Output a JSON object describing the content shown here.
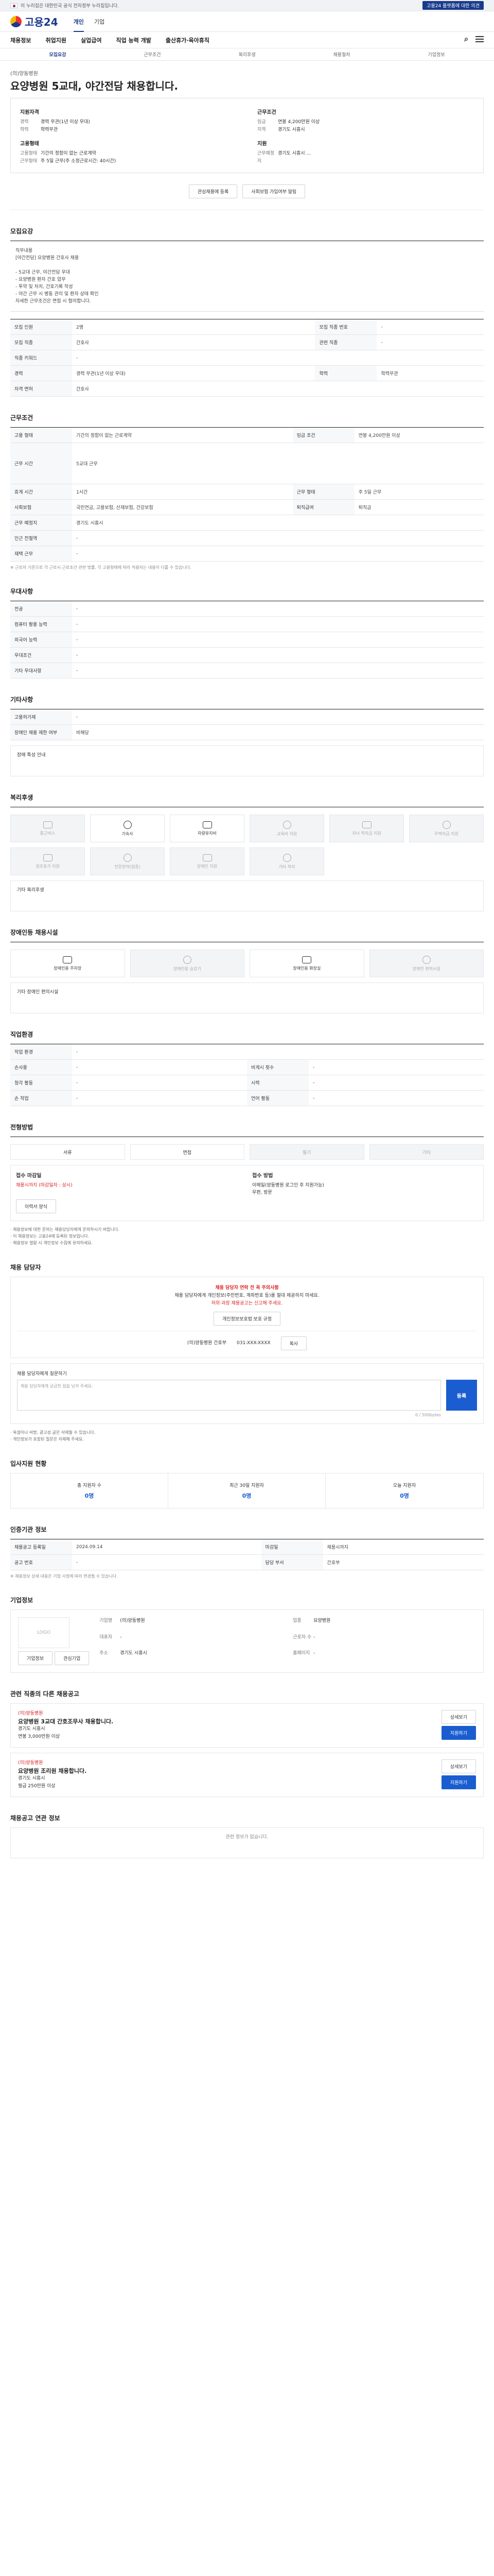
{
  "util": {
    "left_text": "이 누리집은 대한민국 공식 전자정부 누리집입니다.",
    "right_pill": "고용24 플랫폼에 대한 의견"
  },
  "header": {
    "logo": "고용24",
    "tabs": [
      "개인",
      "기업"
    ]
  },
  "gnb": [
    "채용정보",
    "취업지원",
    "실업급여",
    "직업 능력 개발",
    "출산휴가·육아휴직"
  ],
  "subtabs": [
    "모집요강",
    "근무조건",
    "복리후생",
    "채용절차",
    "기업정보"
  ],
  "title": {
    "company": "(의)양동병원",
    "heading": "요양병원 5교대, 야간전담 채용합니다."
  },
  "summary": {
    "left_head1": "지원자격",
    "left_rows1": [
      [
        "경력",
        "경력 무관(1년 이상 우대)"
      ],
      [
        "학력",
        "학력무관"
      ]
    ],
    "left_head2": "고용형태",
    "left_rows2": [
      [
        "고용형태",
        "기간의 정함이 없는 근로계약"
      ],
      [
        "근무형태",
        "주 5일 근무(주 소정근로시간: 40시간)"
      ]
    ],
    "right_head1": "근무조건",
    "right_rows1": [
      [
        "임금",
        "연봉 4,200만원 이상"
      ],
      [
        "지역",
        "경기도 시흥시"
      ]
    ],
    "right_head2": "지원",
    "right_rows2": [
      [
        "근무예정지",
        "경기도 시흥시 ..."
      ]
    ]
  },
  "summary_btns": {
    "b1": "관심채용에 등록",
    "b2": "사회보험 가입여부 알림"
  },
  "sections": {
    "recruit": "모집요강",
    "work": "근무조건",
    "pref": "우대사항",
    "etc": "기타사항",
    "welfare": "복리후생",
    "disabled": "장애인등 채용시설",
    "job": "직업환경",
    "process": "전형방법",
    "apply": "채용 담당자",
    "stats": "입사지원 현황",
    "info": "인증기관 정보",
    "company": "기업정보",
    "related": "관련 직종의 다른 채용공고",
    "similar": "채용공고 연관 정보"
  },
  "recruit_text": "직무내용\n[야간전담] 요양병원 간호사 채용\n\n- 5교대 근무, 야간전담 우대\n- 요양병원 환자 간호 업무\n- 투약 및 처치, 간호기록 작성\n- 야간 근무 시 병동 관리 및 환자 상태 확인\n자세한 근무조건은 면접 시 협의합니다.",
  "recruit_rows": [
    [
      "모집 인원",
      "2명",
      "모집 직종 번호",
      "-"
    ],
    [
      "모집 직종",
      "간호사",
      "관련 직종",
      "-"
    ],
    [
      "직종 키워드",
      "-",
      "",
      ""
    ],
    [
      "경력",
      "경력 무관(1년 이상 우대)",
      "학력",
      "학력무관"
    ],
    [
      "자격 면허",
      "간호사",
      "",
      ""
    ]
  ],
  "work_rows": [
    [
      "고용 형태",
      "기간의 정함이 없는 근로계약",
      "임금 조건",
      "연봉 4,200만원 이상"
    ],
    [
      "근무 시간",
      "5교대 근무",
      "",
      ""
    ],
    [
      "휴게 시간",
      "1시간",
      "근무 형태",
      "주 5일 근무"
    ],
    [
      "사회보험",
      "국민연금, 고용보험, 산재보험, 건강보험",
      "퇴직급여",
      "퇴직금"
    ],
    [
      "근무 예정지",
      "경기도 시흥시",
      "",
      ""
    ],
    [
      "인근 전철역",
      "-",
      "",
      ""
    ],
    [
      "재택 근무",
      "-",
      "",
      ""
    ]
  ],
  "work_note": "※ 근로자 기준으로 각 근로시 근로조건 관련 법률, 각 고용형태에 따라 적용되는 내용이 다를 수 있습니다.",
  "pref_rows": [
    [
      "전공",
      "-"
    ],
    [
      "컴퓨터 활용 능력",
      "-"
    ],
    [
      "외국어 능력",
      "-"
    ],
    [
      "우대조건",
      "-"
    ],
    [
      "기타 우대사항",
      "-"
    ]
  ],
  "etc_rows": [
    [
      "고용허가제",
      "-"
    ],
    [
      "장애인 채용 제한 여부",
      "비해당"
    ]
  ],
  "etc_note": "장애 특성 안내",
  "welfare_cards": [
    {
      "label": "통근버스",
      "on": false
    },
    {
      "label": "기숙사",
      "on": true
    },
    {
      "label": "차량유지비",
      "on": true
    },
    {
      "label": "교육비 지원",
      "on": false
    },
    {
      "label": "자녀 학자금 지원",
      "on": false
    },
    {
      "label": "주택자금 지원",
      "on": false
    },
    {
      "label": "경조휴가 지원",
      "on": false
    },
    {
      "label": "전문분야(업종)",
      "on": false
    },
    {
      "label": "장애인 지원",
      "on": false
    },
    {
      "label": "기타 복리",
      "on": false
    }
  ],
  "welfare_etc": "기타 복리후생",
  "disabled_cards": [
    {
      "label": "장애인용 주차장",
      "on": true
    },
    {
      "label": "장애인용 승강기",
      "on": false
    },
    {
      "label": "장애인용 화장실",
      "on": true
    },
    {
      "label": "장애인 편의시설",
      "on": false
    }
  ],
  "disabled_etc": "기타 장애인 편의시설",
  "job_rows": [
    [
      "작업 환경",
      "-",
      "",
      ""
    ],
    [
      "손사용",
      "-",
      "비게시 횟수",
      "-"
    ],
    [
      "청각 활동",
      "-",
      "시력",
      "-"
    ],
    [
      "손 작업",
      "-",
      "언어 활동",
      "-"
    ]
  ],
  "process_steps": [
    {
      "label": "서류",
      "on": true
    },
    {
      "label": "면접",
      "on": true
    },
    {
      "label": "필기",
      "on": false
    },
    {
      "label": "기타",
      "on": false
    }
  ],
  "apply_info": {
    "h1": "접수 마감일",
    "d1": "채용시까지 (마감일자 : 상시)",
    "h2": "접수 방법",
    "d2": "이메일(양동병원 로그인 후 지원가능)",
    "d3": "우편, 방문",
    "btn": "이력서 양식"
  },
  "apply_bullets": [
    "· 채용정보에 대한 문의는 채용담당자에게 문의하시기 바랍니다.",
    "· 이 채용정보는 고용24에 등록된 정보입니다.",
    "· 채용정보 열람 시 개인정보 수집에 유의하세요."
  ],
  "mgr": {
    "warn": "채용 담당자 연락 전 꼭 주의사항",
    "line1": "채용 담당자에게 개인정보(주민번호, 계좌번호 등)를 절대 제공하지 마세요.",
    "line2": "허위·과장 채용공고는 신고해 주세요.",
    "btn": "개인정보보호법 보호 규정",
    "dept": "(의)양동병원 간호부",
    "tel": "031-XXX-XXXX",
    "btn2": "복사"
  },
  "ta": {
    "label": "채용 담당자에게 질문하기",
    "placeholder": "채용 담당자에게 궁금한 점을 남겨 주세요.",
    "count": "0 / 500bytes",
    "send": "등록"
  },
  "ta_bullets": [
    "· 욕설이나 비방, 광고성 글은 삭제될 수 있습니다.",
    "· 개인정보가 포함된 질문은 자제해 주세요."
  ],
  "stats": [
    {
      "label": "총 지원자 수",
      "n": "0명"
    },
    {
      "label": "최근 30일 지원자",
      "n": "0명"
    },
    {
      "label": "오늘 지원자",
      "n": "0명"
    }
  ],
  "info_rows": [
    [
      "채용공고 등록일",
      "2024.09.14",
      "마감일",
      "채용시까지"
    ],
    [
      "공고 번호",
      "-",
      "담당 부서",
      "간호부"
    ]
  ],
  "info_note": "※ 채용정보 상세 내용은 기업 사정에 따라 변경될 수 있습니다.",
  "company_box": {
    "logo": "LOGO",
    "rows": [
      [
        "기업명",
        "(의)양동병원"
      ],
      [
        "업종",
        "요양병원"
      ],
      [
        "대표자",
        "-"
      ],
      [
        "근로자 수",
        "-"
      ],
      [
        "주소",
        "경기도 시흥시"
      ],
      [
        "홈페이지",
        "-"
      ]
    ],
    "btn1": "기업정보",
    "btn2": "관심기업"
  },
  "related": [
    {
      "co": "(의)양동병원",
      "title": "요양병원 3교대 간호조무사 채용합니다.",
      "d1": "경기도 시흥시",
      "d2": "연봉 3,000만원 이상",
      "b1": "상세보기",
      "b2": "지원하기"
    },
    {
      "co": "(의)양동병원",
      "title": "요양병원 조리원 채용합니다.",
      "d1": "경기도 시흥시",
      "d2": "월급 250만원 이상",
      "b1": "상세보기",
      "b2": "지원하기"
    }
  ],
  "similar_text": "관련 정보가 없습니다."
}
